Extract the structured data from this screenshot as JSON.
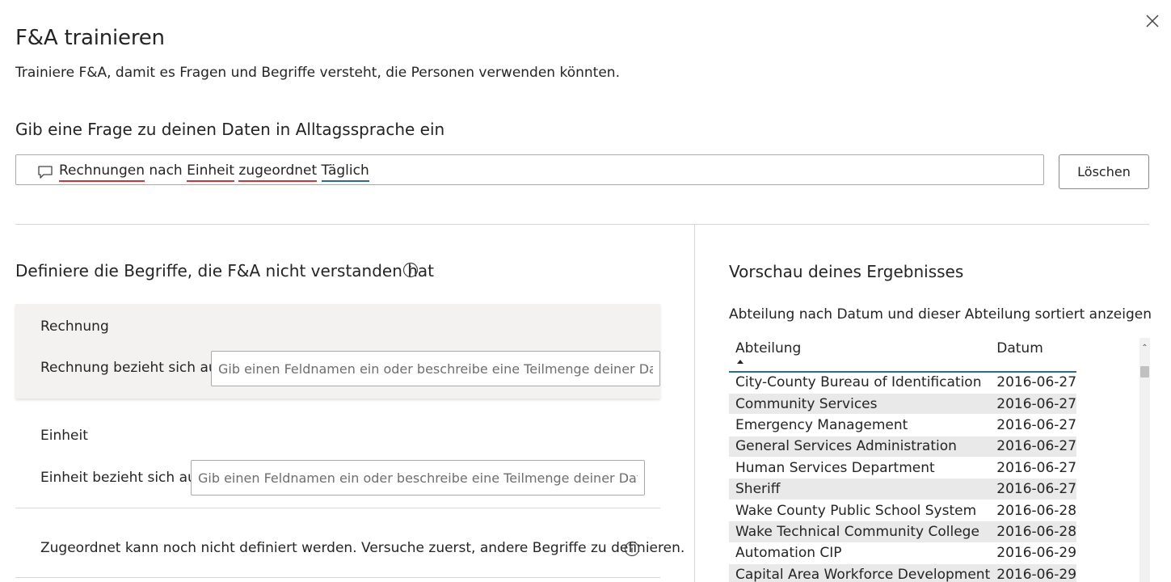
{
  "dialog": {
    "title": "F&A trainieren",
    "subtitle": "Trainiere F&A, damit es Fragen und Begriffe versteht, die Personen verwenden könnten.",
    "close_icon": "close-icon"
  },
  "question": {
    "heading": "Gib eine Frage zu deinen Daten in Alltagssprache ein",
    "icon": "chat-bubble-icon",
    "tokens": [
      {
        "text": "Rechnungen",
        "status": "unrecognized",
        "color": "#d13438"
      },
      {
        "text": "nach",
        "status": "plain"
      },
      {
        "text": "Einheit",
        "status": "unrecognized",
        "color": "#d13438"
      },
      {
        "text": "zugeordnet",
        "status": "unrecognized",
        "color": "#d13438"
      },
      {
        "text": "Täglich",
        "status": "recognized",
        "color": "#2b6a9b"
      }
    ],
    "clear_label": "Löschen"
  },
  "define": {
    "heading": "Definiere die Begriffe, die F&A nicht verstanden hat",
    "info_icon": "info-icon",
    "terms": [
      {
        "name": "Rechnung",
        "label": "Rechnung bezieht sich auf",
        "placeholder": "Gib einen Feldnamen ein oder beschreibe eine Teilmenge deiner Daten",
        "value": ""
      },
      {
        "name": "Einheit",
        "label": "Einheit bezieht sich auf",
        "placeholder": "Gib einen Feldnamen ein oder beschreibe eine Teilmenge deiner Daten",
        "value": ""
      }
    ],
    "unresolved_note": "Zugeordnet kann noch nicht definiert werden. Versuche zuerst, andere Begriffe zu definieren."
  },
  "preview": {
    "heading": "Vorschau deines Ergebnisses",
    "subtitle": "Abteilung nach Datum und dieser Abteilung sortiert anzeigen",
    "columns": [
      "Abteilung",
      "Datum"
    ],
    "sorted_column": "Abteilung",
    "rows": [
      [
        "City-County Bureau of Identification",
        "2016-06-27"
      ],
      [
        "Community Services",
        "2016-06-27"
      ],
      [
        "Emergency Management",
        "2016-06-27"
      ],
      [
        "General Services Administration",
        "2016-06-27"
      ],
      [
        "Human Services Department",
        "2016-06-27"
      ],
      [
        "Sheriff",
        "2016-06-27"
      ],
      [
        "Wake County Public School System",
        "2016-06-28"
      ],
      [
        "Wake Technical Community College",
        "2016-06-28"
      ],
      [
        "Automation CIP",
        "2016-06-29"
      ],
      [
        "Capital Area Workforce Development",
        "2016-06-29"
      ]
    ]
  },
  "colors": {
    "error_underline": "#d13438",
    "recognized_underline": "#2b6a9b",
    "card_background": "#f3f2f1",
    "row_stripe": "#e9e9e9"
  }
}
